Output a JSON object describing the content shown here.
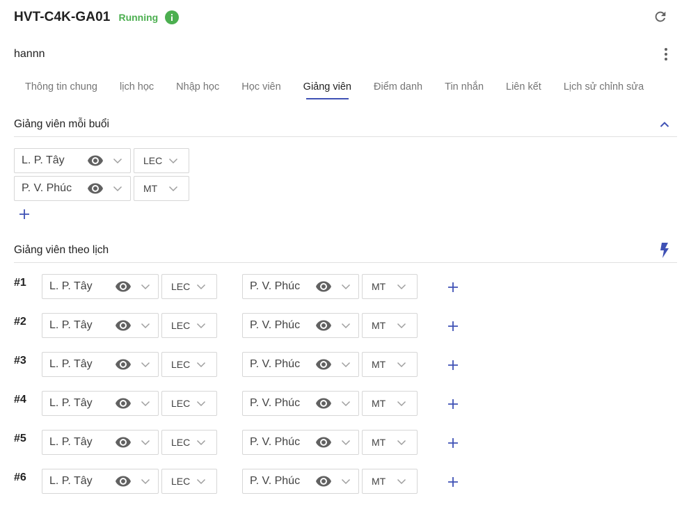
{
  "header": {
    "class_code": "HVT-C4K-GA01",
    "status": "Running",
    "status_color": "#4caf50",
    "info_icon": "info-icon",
    "refresh_icon": "refresh-icon"
  },
  "subheader": {
    "owner": "hannn",
    "menu_icon": "more-vert-icon"
  },
  "tabs": [
    {
      "label": "Thông tin chung",
      "active": false
    },
    {
      "label": "lịch học",
      "active": false
    },
    {
      "label": "Nhập học",
      "active": false
    },
    {
      "label": "Học viên",
      "active": false
    },
    {
      "label": "Giảng viên",
      "active": true
    },
    {
      "label": "Điểm danh",
      "active": false
    },
    {
      "label": "Tin nhắn",
      "active": false
    },
    {
      "label": "Liên kết",
      "active": false
    },
    {
      "label": "Lịch sử chỉnh sửa",
      "active": false
    }
  ],
  "accent_color": "#3f51b5",
  "per_session": {
    "title": "Giảng viên mỗi buổi",
    "teachers": [
      {
        "name": "L. P. Tây",
        "role": "LEC"
      },
      {
        "name": "P. V. Phúc",
        "role": "MT"
      }
    ]
  },
  "by_schedule": {
    "title": "Giảng viên theo lịch",
    "rows": [
      {
        "num": "#1",
        "teachers": [
          {
            "name": "L. P. Tây",
            "role": "LEC"
          },
          {
            "name": "P. V. Phúc",
            "role": "MT"
          }
        ]
      },
      {
        "num": "#2",
        "teachers": [
          {
            "name": "L. P. Tây",
            "role": "LEC"
          },
          {
            "name": "P. V. Phúc",
            "role": "MT"
          }
        ]
      },
      {
        "num": "#3",
        "teachers": [
          {
            "name": "L. P. Tây",
            "role": "LEC"
          },
          {
            "name": "P. V. Phúc",
            "role": "MT"
          }
        ]
      },
      {
        "num": "#4",
        "teachers": [
          {
            "name": "L. P. Tây",
            "role": "LEC"
          },
          {
            "name": "P. V. Phúc",
            "role": "MT"
          }
        ]
      },
      {
        "num": "#5",
        "teachers": [
          {
            "name": "L. P. Tây",
            "role": "LEC"
          },
          {
            "name": "P. V. Phúc",
            "role": "MT"
          }
        ]
      },
      {
        "num": "#6",
        "teachers": [
          {
            "name": "L. P. Tây",
            "role": "LEC"
          },
          {
            "name": "P. V. Phúc",
            "role": "MT"
          }
        ]
      }
    ]
  }
}
